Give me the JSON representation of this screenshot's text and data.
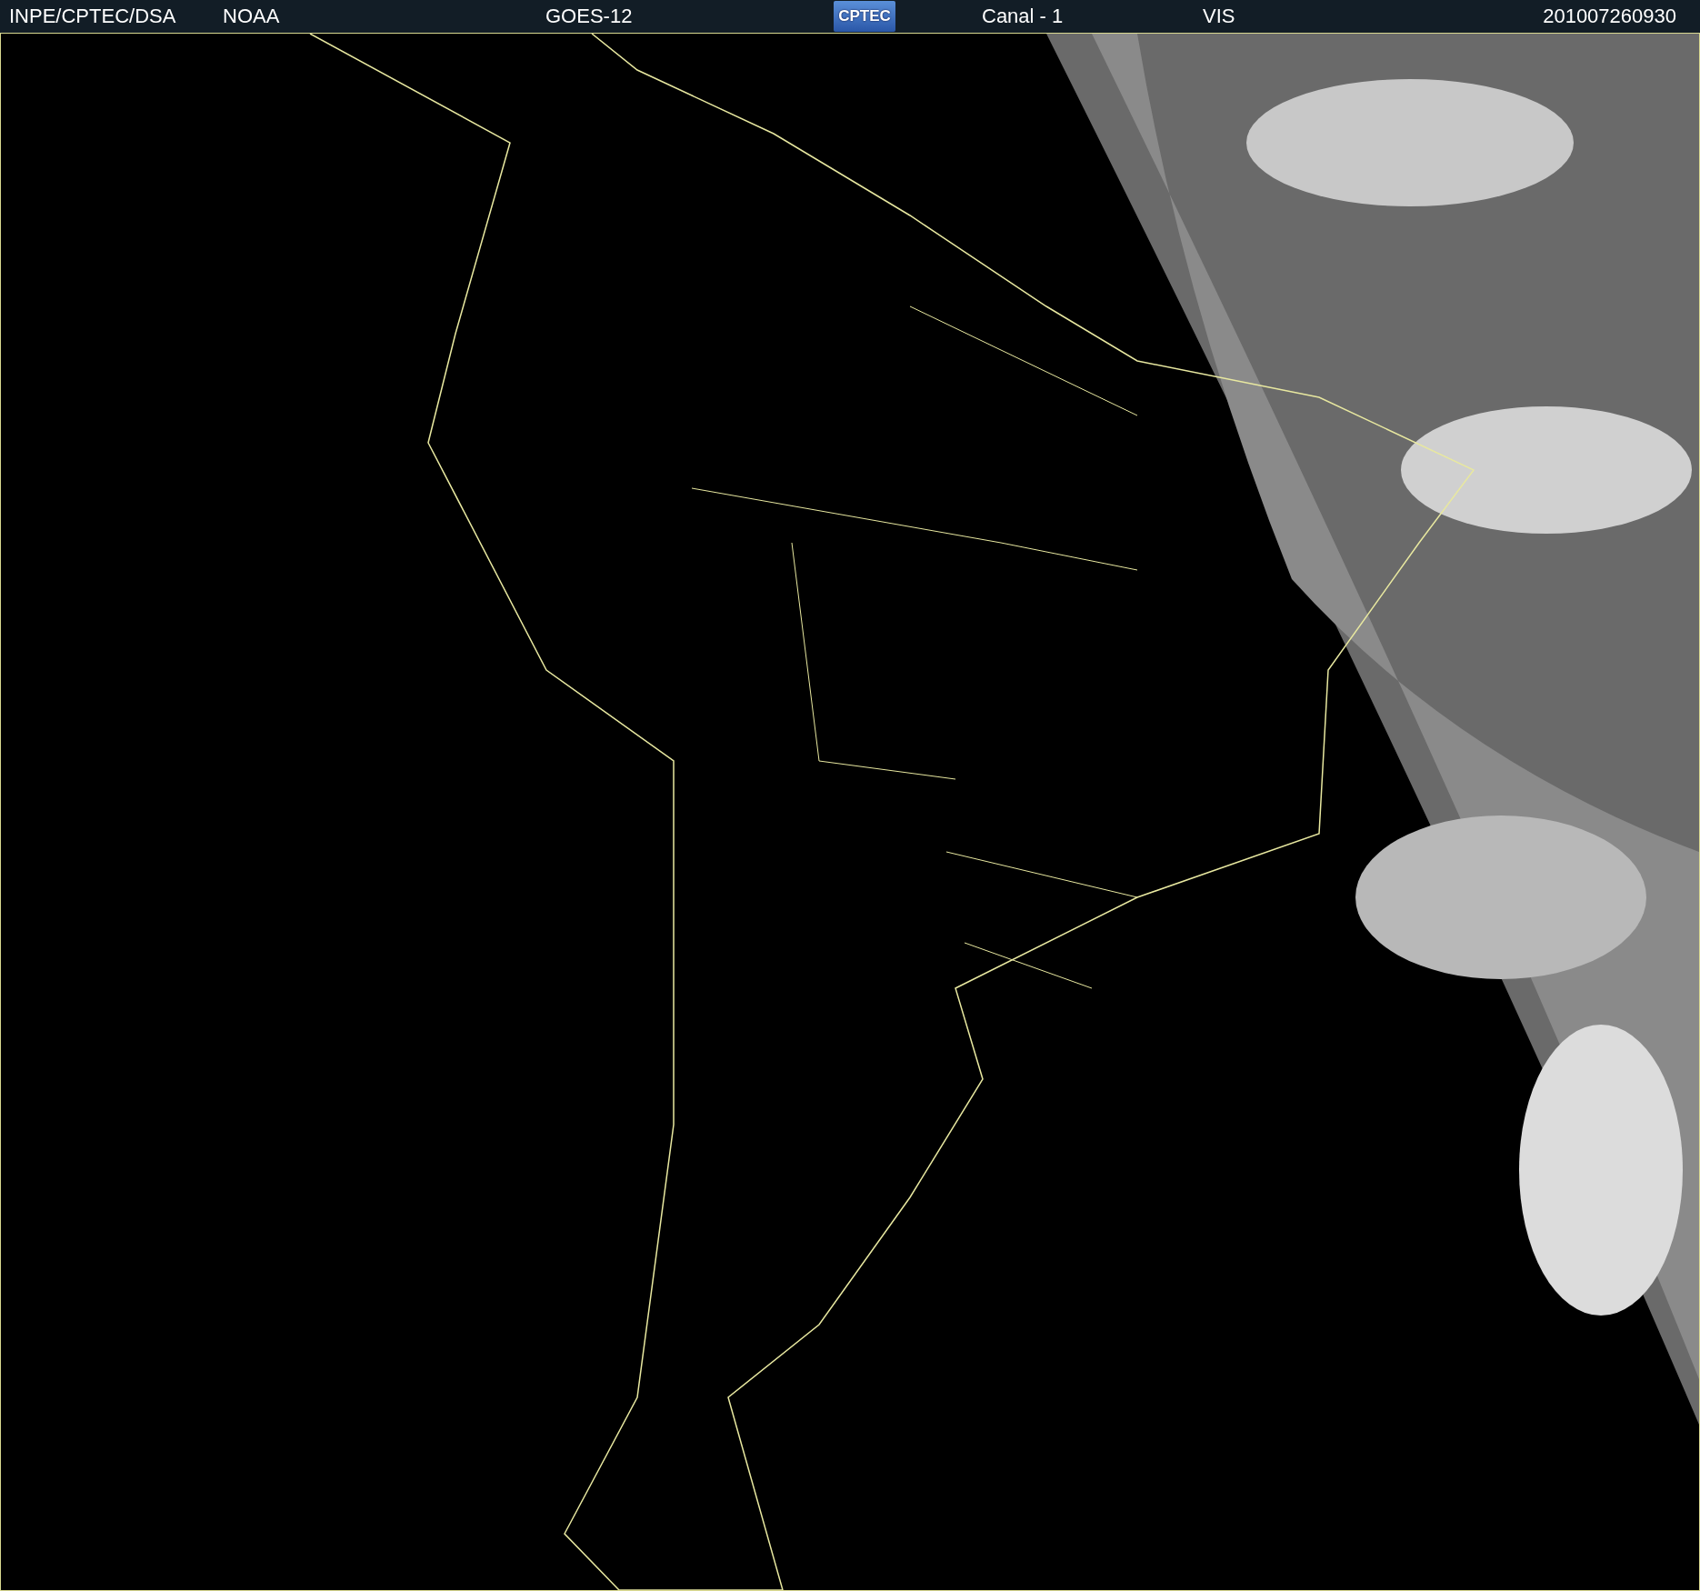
{
  "header": {
    "source": "INPE/CPTEC/DSA",
    "agency": "NOAA",
    "satellite": "GOES-12",
    "logo_text": "CPTEC",
    "channel": "Canal - 1",
    "band": "VIS",
    "timestamp": "201007260930"
  }
}
